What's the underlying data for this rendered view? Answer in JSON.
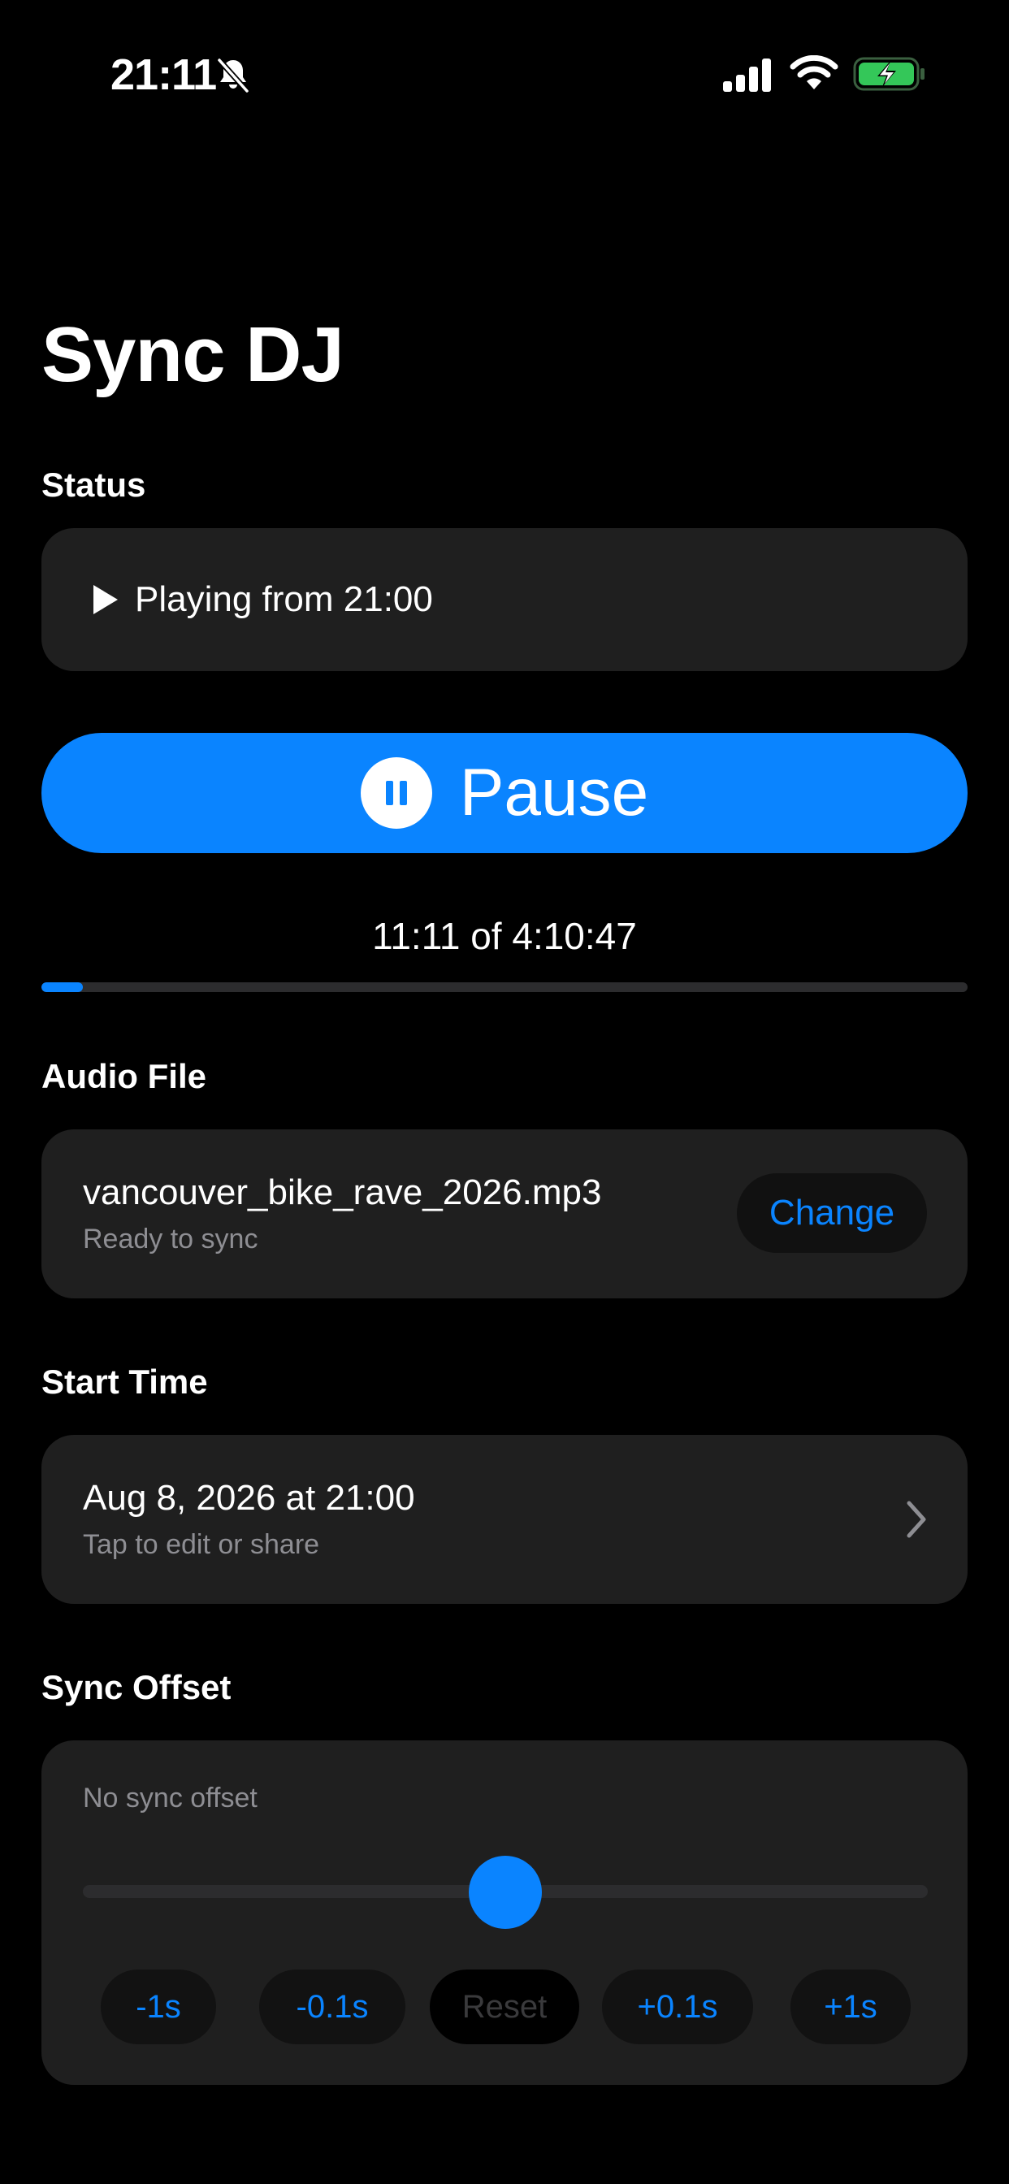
{
  "status_bar": {
    "time": "21:11",
    "icons": [
      "bell-slash-icon",
      "cellular-signal-icon",
      "wifi-icon",
      "battery-charging-icon"
    ],
    "battery_color": "#34c759"
  },
  "app": {
    "title": "Sync DJ"
  },
  "status": {
    "label": "Status",
    "text": "Playing from 21:00",
    "icon": "play-icon"
  },
  "playback": {
    "button_label": "Pause",
    "button_icon": "pause-circle-icon",
    "elapsed_text": "11:11 of 4:10:47",
    "progress_fraction": 0.0446
  },
  "audio_file": {
    "label": "Audio File",
    "file_name": "vancouver_bike_rave_2026.mp3",
    "subtitle": "Ready to sync",
    "change_label": "Change"
  },
  "start_time": {
    "label": "Start Time",
    "date_text": "Aug 8, 2026 at 21:00",
    "subtitle": "Tap to edit or share",
    "icon": "chevron-right-icon"
  },
  "sync_offset": {
    "label": "Sync Offset",
    "status_text": "No sync offset",
    "slider_fraction": 0.5,
    "buttons": {
      "minus_1": "-1s",
      "minus_01": "-0.1s",
      "reset": "Reset",
      "plus_01": "+0.1s",
      "plus_1": "+1s"
    }
  },
  "colors": {
    "accent": "#0a84ff",
    "card": "#1f1f1f",
    "secondary_text": "#8e8e93",
    "background": "#000000"
  }
}
